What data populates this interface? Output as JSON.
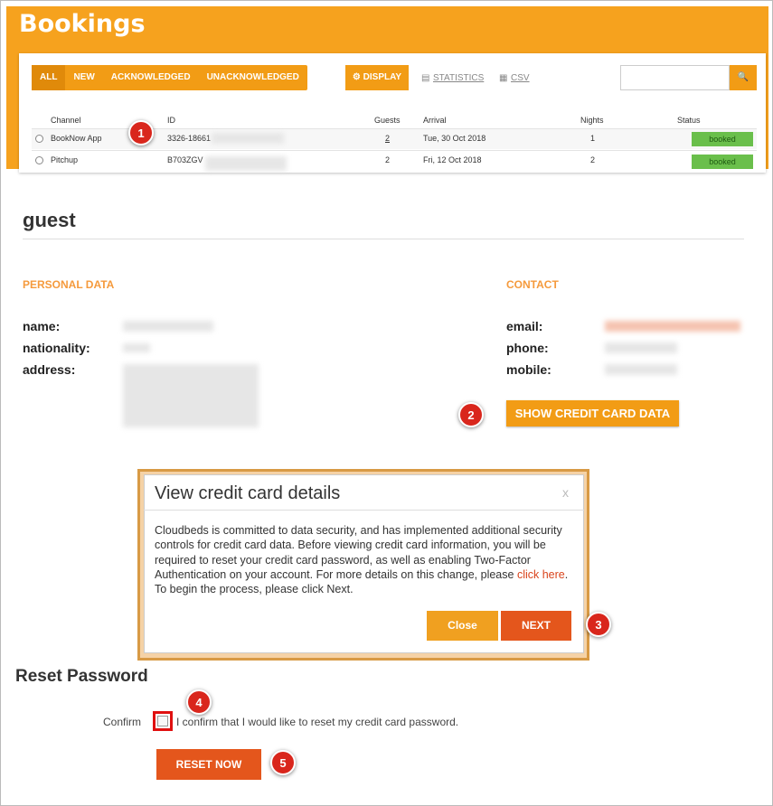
{
  "header": {
    "title": "Bookings"
  },
  "filters": [
    "ALL",
    "NEW",
    "ACKNOWLEDGED",
    "UNACKNOWLEDGED"
  ],
  "toolbar": {
    "display": "⚙ DISPLAY",
    "statistics": "STATISTICS",
    "csv": "CSV",
    "search_icon": "🔍"
  },
  "table": {
    "headers": {
      "channel": "Channel",
      "id": "ID",
      "guests": "Guests",
      "arrival": "Arrival",
      "nights": "Nights",
      "status": "Status"
    },
    "rows": [
      {
        "channel": "BookNow App",
        "id": "3326-18661",
        "guests": "2",
        "arrival": "Tue, 30 Oct 2018",
        "nights": "1",
        "status": "booked"
      },
      {
        "channel": "Pitchup",
        "id": "B703ZGV",
        "guests": "2",
        "arrival": "Fri, 12 Oct 2018",
        "nights": "2",
        "status": "booked"
      }
    ]
  },
  "guest": {
    "heading": "guest",
    "personal_heading": "PERSONAL DATA",
    "contact_heading": "CONTACT",
    "labels": {
      "name": "name:",
      "nationality": "nationality:",
      "address": "address:",
      "email": "email:",
      "phone": "phone:",
      "mobile": "mobile:"
    },
    "show_cc_button": "SHOW CREDIT CARD DATA"
  },
  "modal": {
    "title": "View credit card details",
    "close_x": "x",
    "body_1": "Cloudbeds is committed to data security, and has implemented additional security controls for credit card data. Before viewing credit card information, you will be required to reset your credit card password, as well as enabling Two-Factor Authentication on your account. For more details on this change, please ",
    "link": "click here",
    "body_2": ". To begin the process, please click Next.",
    "close_button": "Close",
    "next_button": "NEXT"
  },
  "reset": {
    "heading": "Reset Password",
    "confirm_label": "Confirm",
    "confirm_text": "I confirm that I would like to reset my credit card password.",
    "button": "RESET NOW"
  },
  "steps": [
    "1",
    "2",
    "3",
    "4",
    "5"
  ],
  "colors": {
    "accent": "#f29c15",
    "danger": "#e4561c",
    "status_green": "#6abf4b",
    "step_red": "#d9261c"
  }
}
